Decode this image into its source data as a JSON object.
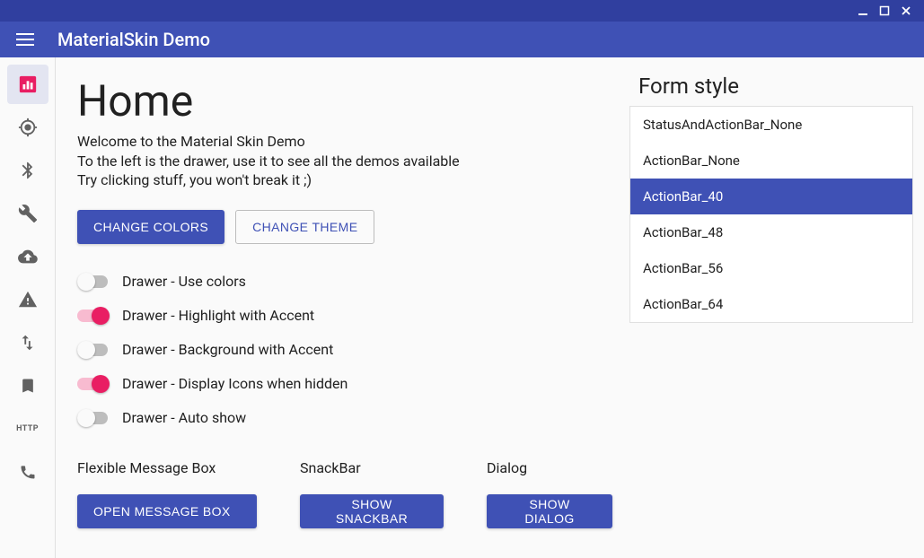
{
  "window": {
    "title": "MaterialSkin Demo"
  },
  "page": {
    "heading": "Home",
    "intro_line1": "Welcome to the Material Skin Demo",
    "intro_line2": "To the left is the drawer, use it to see all the demos available",
    "intro_line3": "Try clicking stuff, you won't break it ;)"
  },
  "buttons": {
    "change_colors": "CHANGE COLORS",
    "change_theme": "CHANGE THEME",
    "open_message_box": "OPEN MESSAGE BOX",
    "show_snackbar": "SHOW SNACKBAR",
    "show_dialog": "SHOW DIALOG"
  },
  "switches": {
    "use_colors": {
      "label": "Drawer - Use colors",
      "on": false
    },
    "highlight_accent": {
      "label": "Drawer - Highlight with Accent",
      "on": true
    },
    "background_accent": {
      "label": "Drawer - Background with Accent",
      "on": false
    },
    "display_icons": {
      "label": "Drawer - Display Icons when hidden",
      "on": true
    },
    "auto_show": {
      "label": "Drawer - Auto show",
      "on": false
    }
  },
  "sections": {
    "flexible_messagebox": "Flexible Message Box",
    "snackbar": "SnackBar",
    "dialog": "Dialog"
  },
  "formstyle": {
    "title": "Form style",
    "items": [
      "StatusAndActionBar_None",
      "ActionBar_None",
      "ActionBar_40",
      "ActionBar_48",
      "ActionBar_56",
      "ActionBar_64"
    ],
    "selected_index": 2
  },
  "drawer": {
    "items": [
      "home",
      "target",
      "bluetooth",
      "tools",
      "cloud-upload",
      "warning",
      "import-export",
      "bookmark",
      "http",
      "phone"
    ],
    "selected_index": 0
  },
  "colors": {
    "primary": "#3f51b5",
    "primary_dark": "#303f9f",
    "accent": "#e91e63"
  }
}
